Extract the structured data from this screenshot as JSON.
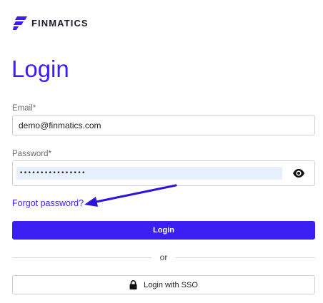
{
  "brand": {
    "name": "FINMATICS",
    "logo_icon": "finmatics-logo-icon",
    "color": "#3b1ff2"
  },
  "title": "Login",
  "email": {
    "label": "Email",
    "required_mark": "*",
    "value": "demo@finmatics.com"
  },
  "password": {
    "label": "Password",
    "required_mark": "*",
    "value": "••••••••••••••••",
    "toggle_icon": "eye-icon"
  },
  "forgot_link": "Forgot password?",
  "login_button": "Login",
  "divider": "or",
  "sso_button": {
    "label": "Login with SSO",
    "icon": "lock-icon"
  },
  "annotation": {
    "icon": "arrow-icon",
    "color": "#2b14d9"
  }
}
